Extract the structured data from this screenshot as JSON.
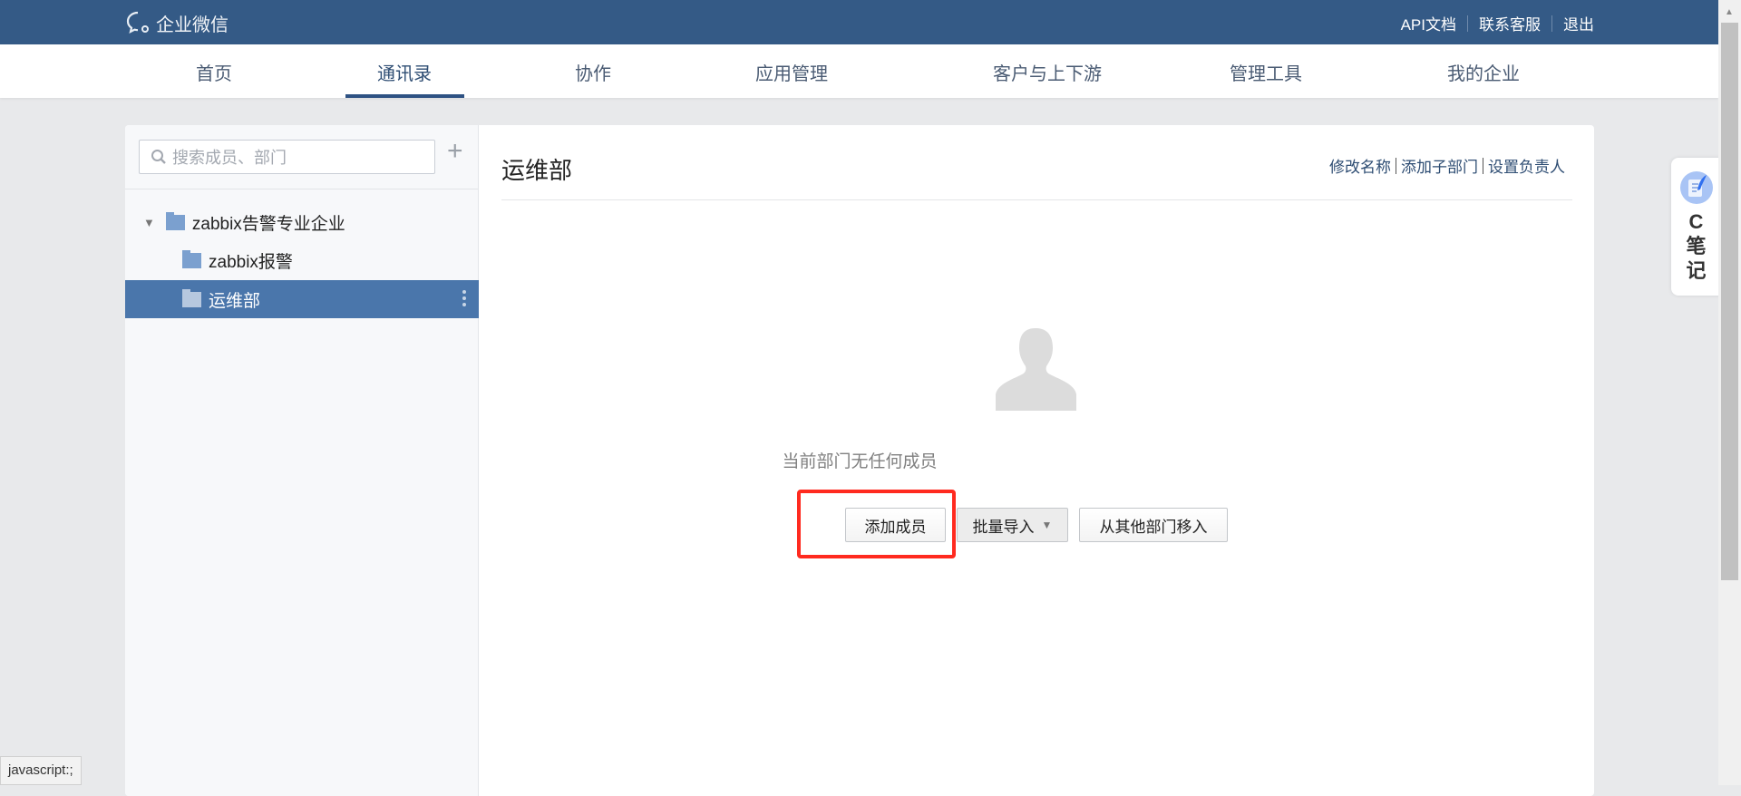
{
  "header": {
    "brand": "企业微信",
    "links": [
      "API文档",
      "联系客服",
      "退出"
    ]
  },
  "nav": {
    "items": [
      "首页",
      "通讯录",
      "协作",
      "应用管理",
      "客户与上下游",
      "管理工具",
      "我的企业"
    ],
    "active": "通讯录"
  },
  "sidebar": {
    "search_placeholder": "搜索成员、部门",
    "tree": [
      {
        "label": "zabbix告警专业企业"
      },
      {
        "label": "zabbix报警"
      },
      {
        "label": "运维部",
        "selected": true
      }
    ]
  },
  "main": {
    "title": "运维部",
    "links": [
      "修改名称",
      "添加子部门",
      "设置负责人"
    ],
    "empty_text": "当前部门无任何成员",
    "buttons": {
      "add": "添加成员",
      "batch": "批量导入",
      "move": "从其他部门移入"
    }
  },
  "widget": {
    "label": "C笔记",
    "chars": [
      "C",
      "笔",
      "记"
    ]
  },
  "status_bar": "javascript:;",
  "colors": {
    "header": "#345a86",
    "selected": "#4a76ab",
    "highlight": "#ff2a1f"
  }
}
